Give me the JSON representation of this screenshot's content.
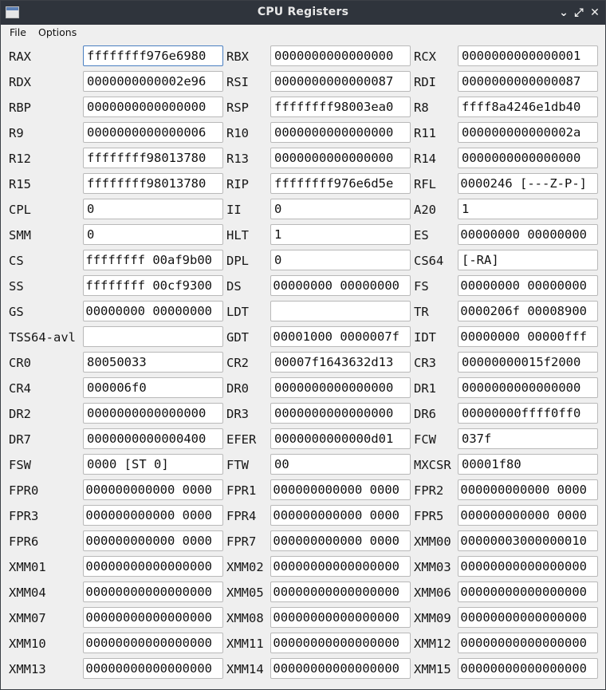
{
  "window": {
    "title": "CPU Registers"
  },
  "menu": [
    "File",
    "Options"
  ],
  "rows": [
    [
      {
        "label": "RAX",
        "value": "ffffffff976e6980",
        "align": "left",
        "focused": true
      },
      {
        "label": "RBX",
        "value": "0000000000000000",
        "align": "left"
      },
      {
        "label": "RCX",
        "value": "0000000000000001",
        "align": "left"
      }
    ],
    [
      {
        "label": "RDX",
        "value": "0000000000002e96",
        "align": "left"
      },
      {
        "label": "RSI",
        "value": "0000000000000087",
        "align": "left"
      },
      {
        "label": "RDI",
        "value": "0000000000000087",
        "align": "left"
      }
    ],
    [
      {
        "label": "RBP",
        "value": "0000000000000000",
        "align": "left"
      },
      {
        "label": "RSP",
        "value": "ffffffff98003ea0",
        "align": "left"
      },
      {
        "label": "R8",
        "value": "ffff8a4246e1db40",
        "align": "left"
      }
    ],
    [
      {
        "label": "R9",
        "value": "0000000000000006",
        "align": "left"
      },
      {
        "label": "R10",
        "value": "0000000000000000",
        "align": "left"
      },
      {
        "label": "R11",
        "value": "000000000000002a",
        "align": "left"
      }
    ],
    [
      {
        "label": "R12",
        "value": "ffffffff98013780",
        "align": "left"
      },
      {
        "label": "R13",
        "value": "0000000000000000",
        "align": "left"
      },
      {
        "label": "R14",
        "value": "0000000000000000",
        "align": "left"
      }
    ],
    [
      {
        "label": "R15",
        "value": "ffffffff98013780",
        "align": "left"
      },
      {
        "label": "RIP",
        "value": "ffffffff976e6d5e",
        "align": "left"
      },
      {
        "label": "RFL",
        "value": "0000246 [---Z-P-]",
        "align": "right"
      }
    ],
    [
      {
        "label": "CPL",
        "value": "0",
        "align": "left"
      },
      {
        "label": "II",
        "value": "0",
        "align": "left"
      },
      {
        "label": "A20",
        "value": "1",
        "align": "left"
      }
    ],
    [
      {
        "label": "SMM",
        "value": "0",
        "align": "left"
      },
      {
        "label": "HLT",
        "value": "1",
        "align": "left"
      },
      {
        "label": "ES",
        "value": "00000000 00000000",
        "align": "right"
      }
    ],
    [
      {
        "label": "CS",
        "value": "ffffffff 00af9b00",
        "align": "right"
      },
      {
        "label": "DPL",
        "value": "0",
        "align": "left"
      },
      {
        "label": "CS64",
        "value": "[-RA]",
        "align": "left"
      }
    ],
    [
      {
        "label": "SS",
        "value": "ffffffff 00cf9300",
        "align": "right"
      },
      {
        "label": "DS",
        "value": "00000000 00000000",
        "align": "right"
      },
      {
        "label": "FS",
        "value": "00000000 00000000",
        "align": "right"
      }
    ],
    [
      {
        "label": "GS",
        "value": "00000000 00000000",
        "align": "right"
      },
      {
        "label": "LDT",
        "value": "",
        "align": "left"
      },
      {
        "label": "TR",
        "value": "0000206f 00008900",
        "align": "right"
      }
    ],
    [
      {
        "label": "TSS64-avl",
        "value": "",
        "align": "left"
      },
      {
        "label": "GDT",
        "value": "00001000 0000007f",
        "align": "right"
      },
      {
        "label": "IDT",
        "value": "00000000 00000fff",
        "align": "right"
      }
    ],
    [
      {
        "label": "CR0",
        "value": "80050033",
        "align": "left"
      },
      {
        "label": "CR2",
        "value": "00007f1643632d13",
        "align": "left"
      },
      {
        "label": "CR3",
        "value": "00000000015f2000",
        "align": "left"
      }
    ],
    [
      {
        "label": "CR4",
        "value": "000006f0",
        "align": "left"
      },
      {
        "label": "DR0",
        "value": "0000000000000000",
        "align": "left"
      },
      {
        "label": "DR1",
        "value": "0000000000000000",
        "align": "left"
      }
    ],
    [
      {
        "label": "DR2",
        "value": "0000000000000000",
        "align": "left"
      },
      {
        "label": "DR3",
        "value": "0000000000000000",
        "align": "left"
      },
      {
        "label": "DR6",
        "value": "00000000ffff0ff0",
        "align": "left"
      }
    ],
    [
      {
        "label": "DR7",
        "value": "0000000000000400",
        "align": "left"
      },
      {
        "label": "EFER",
        "value": "0000000000000d01",
        "align": "left"
      },
      {
        "label": "FCW",
        "value": "037f",
        "align": "left"
      }
    ],
    [
      {
        "label": "FSW",
        "value": "0000 [ST 0]",
        "align": "left"
      },
      {
        "label": "FTW",
        "value": "00",
        "align": "left"
      },
      {
        "label": "MXCSR",
        "value": "00001f80",
        "align": "left"
      }
    ],
    [
      {
        "label": "FPR0",
        "value": "000000000000 0000",
        "align": "right"
      },
      {
        "label": "FPR1",
        "value": "000000000000 0000",
        "align": "right"
      },
      {
        "label": "FPR2",
        "value": "000000000000 0000",
        "align": "right"
      }
    ],
    [
      {
        "label": "FPR3",
        "value": "000000000000 0000",
        "align": "right"
      },
      {
        "label": "FPR4",
        "value": "000000000000 0000",
        "align": "right"
      },
      {
        "label": "FPR5",
        "value": "000000000000 0000",
        "align": "right"
      }
    ],
    [
      {
        "label": "FPR6",
        "value": "000000000000 0000",
        "align": "right"
      },
      {
        "label": "FPR7",
        "value": "000000000000 0000",
        "align": "right"
      },
      {
        "label": "XMM00",
        "value": "00000003000000010",
        "align": "right"
      }
    ],
    [
      {
        "label": "XMM01",
        "value": "00000000000000000",
        "align": "right"
      },
      {
        "label": "XMM02",
        "value": "00000000000000000",
        "align": "right"
      },
      {
        "label": "XMM03",
        "value": "00000000000000000",
        "align": "right"
      }
    ],
    [
      {
        "label": "XMM04",
        "value": "00000000000000000",
        "align": "right"
      },
      {
        "label": "XMM05",
        "value": "00000000000000000",
        "align": "right"
      },
      {
        "label": "XMM06",
        "value": "00000000000000000",
        "align": "right"
      }
    ],
    [
      {
        "label": "XMM07",
        "value": "00000000000000000",
        "align": "right"
      },
      {
        "label": "XMM08",
        "value": "00000000000000000",
        "align": "right"
      },
      {
        "label": "XMM09",
        "value": "00000000000000000",
        "align": "right"
      }
    ],
    [
      {
        "label": "XMM10",
        "value": "00000000000000000",
        "align": "right"
      },
      {
        "label": "XMM11",
        "value": "00000000000000000",
        "align": "right"
      },
      {
        "label": "XMM12",
        "value": "00000000000000000",
        "align": "right"
      }
    ],
    [
      {
        "label": "XMM13",
        "value": "00000000000000000",
        "align": "right"
      },
      {
        "label": "XMM14",
        "value": "00000000000000000",
        "align": "right"
      },
      {
        "label": "XMM15",
        "value": "00000000000000000",
        "align": "right"
      }
    ]
  ]
}
